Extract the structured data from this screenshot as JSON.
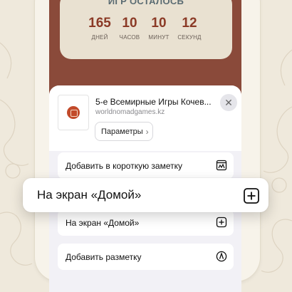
{
  "countdown": {
    "title": "ИГР ОСТАЛОСЬ",
    "units": [
      {
        "value": "165",
        "label": "ДНЕЙ"
      },
      {
        "value": "10",
        "label": "ЧАСОВ"
      },
      {
        "value": "10",
        "label": "МИНУТ"
      },
      {
        "value": "12",
        "label": "СЕКУНД"
      }
    ]
  },
  "share": {
    "title": "5-е Всемирные Игры Кочев...",
    "url": "worldnomadgames.kz",
    "params_label": "Параметры",
    "actions": [
      {
        "label": "Добавить в короткую заметку",
        "icon": "quick-note-icon"
      },
      {
        "label": "На экран «Домой»",
        "icon": "add-square-icon"
      },
      {
        "label": "Добавить разметку",
        "icon": "markup-icon"
      }
    ]
  },
  "highlight": {
    "label": "На экран «Домой»",
    "icon": "add-square-icon"
  },
  "colors": {
    "brand_dark": "#8a4a3a",
    "countdown_number": "#8b3a26",
    "sheet_bg": "#f2f1f6"
  }
}
